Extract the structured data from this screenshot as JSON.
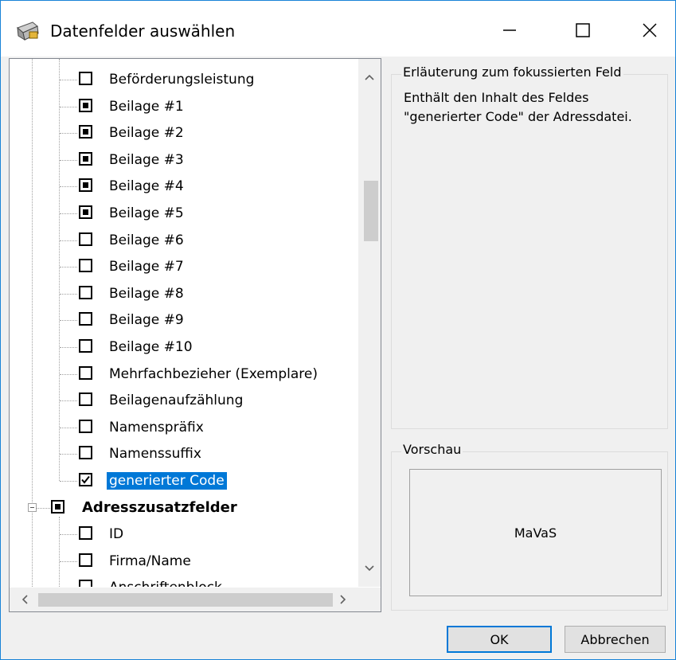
{
  "window": {
    "title": "Datenfelder auswählen",
    "icons": {
      "app": "address-book-icon",
      "minimize": "minimize-icon",
      "maximize": "maximize-icon",
      "close": "close-icon"
    }
  },
  "tree": {
    "items": [
      {
        "label": "Beförderungsleistung",
        "state": "unchecked"
      },
      {
        "label": "Beilage #1",
        "state": "indeterminate"
      },
      {
        "label": "Beilage #2",
        "state": "indeterminate"
      },
      {
        "label": "Beilage #3",
        "state": "indeterminate"
      },
      {
        "label": "Beilage #4",
        "state": "indeterminate"
      },
      {
        "label": "Beilage #5",
        "state": "indeterminate"
      },
      {
        "label": "Beilage #6",
        "state": "unchecked"
      },
      {
        "label": "Beilage #7",
        "state": "unchecked"
      },
      {
        "label": "Beilage #8",
        "state": "unchecked"
      },
      {
        "label": "Beilage #9",
        "state": "unchecked"
      },
      {
        "label": "Beilage #10",
        "state": "unchecked"
      },
      {
        "label": "Mehrfachbezieher (Exemplare)",
        "state": "unchecked"
      },
      {
        "label": "Beilagenaufzählung",
        "state": "unchecked"
      },
      {
        "label": "Namenspräfix",
        "state": "unchecked"
      },
      {
        "label": "Namenssuffix",
        "state": "unchecked"
      },
      {
        "label": "generierter Code",
        "state": "checked",
        "selected": true
      }
    ],
    "group": {
      "label": "Adresszusatzfelder",
      "state": "indeterminate",
      "expanded": true
    },
    "group_items": [
      {
        "label": "ID",
        "state": "unchecked"
      },
      {
        "label": "Firma/Name",
        "state": "unchecked"
      },
      {
        "label": "Anschriftenblock",
        "state": "unchecked"
      }
    ]
  },
  "description": {
    "title": "Erläuterung zum fokussierten Feld",
    "line1": "Enthält den Inhalt des Feldes",
    "line2": "\"generierter Code\" der Adressdatei."
  },
  "preview": {
    "title": "Vorschau",
    "value": "MaVaS"
  },
  "buttons": {
    "ok": "OK",
    "cancel": "Abbrechen"
  }
}
